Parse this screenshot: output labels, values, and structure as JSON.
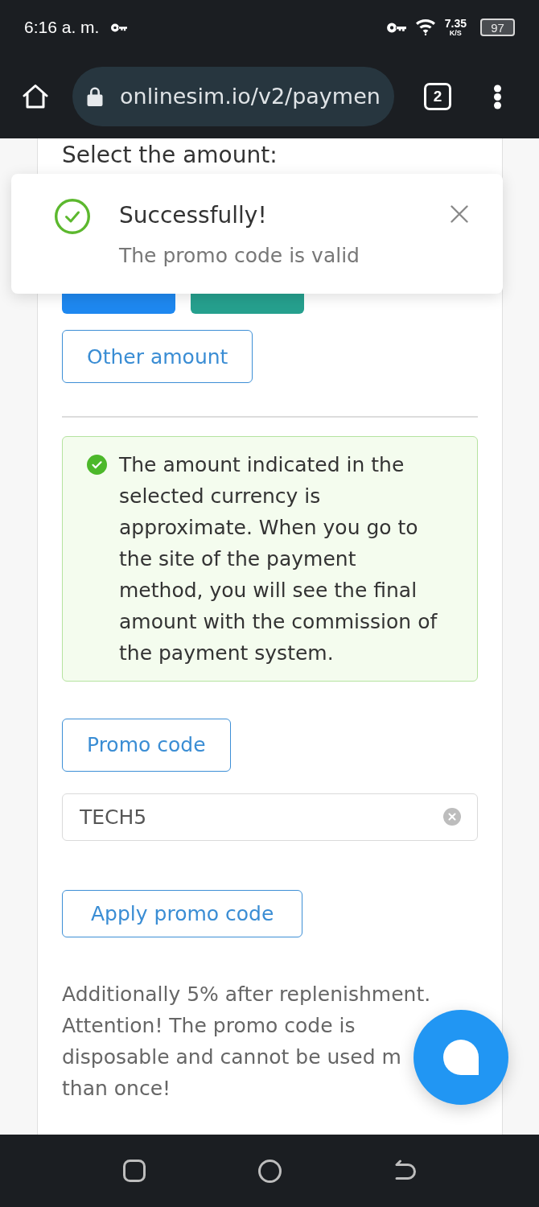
{
  "status_bar": {
    "time": "6:16 a. m.",
    "network_speed": "7.35",
    "network_speed_unit": "K/S",
    "battery": "97"
  },
  "browser": {
    "url": "onlinesim.io/v2/paymen",
    "tab_count": "2"
  },
  "page": {
    "heading": "Select the amount:",
    "amount_buttons": [
      {
        "color": "#1e88f0"
      },
      {
        "color": "#26a08e"
      }
    ],
    "other_amount_button": "Other amount",
    "notice": "The amount indicated in the selected currency is approximate. When you go to the site of the payment method, you will see the final amount with the commission of the payment system.",
    "promo_code_button": "Promo code",
    "promo_code_field": {
      "value": "TECH5"
    },
    "apply_button": "Apply promo code",
    "note_lines": [
      "Additionally 5% after replenishment.",
      "Attention! The promo code is",
      "disposable and cannot be used m",
      "than once!"
    ]
  },
  "toast": {
    "title": "Successfully!",
    "message": "The promo code is valid"
  }
}
